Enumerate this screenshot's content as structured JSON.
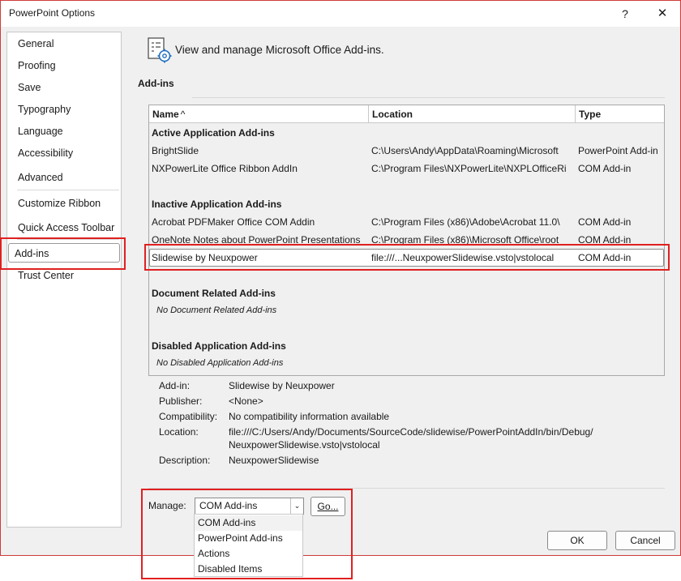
{
  "window": {
    "title": "PowerPoint Options",
    "help_glyph": "?",
    "close_glyph": "✕"
  },
  "sidebar": {
    "items": [
      {
        "label": "General"
      },
      {
        "label": "Proofing"
      },
      {
        "label": "Save"
      },
      {
        "label": "Typography"
      },
      {
        "label": "Language"
      },
      {
        "label": "Accessibility"
      },
      {
        "label": "Advanced"
      },
      {
        "label": "Customize Ribbon"
      },
      {
        "label": "Quick Access Toolbar"
      },
      {
        "label": "Add-ins",
        "selected": true
      },
      {
        "label": "Trust Center"
      }
    ]
  },
  "header": {
    "text": "View and manage Microsoft Office Add-ins.",
    "icon": "addins-gear-icon"
  },
  "section": {
    "label": "Add-ins"
  },
  "table": {
    "columns": {
      "name": "Name",
      "name_sort": "^",
      "location": "Location",
      "type": "Type"
    },
    "groups": {
      "active": {
        "heading": "Active Application Add-ins",
        "rows": [
          {
            "name": "BrightSlide",
            "location": "C:\\Users\\Andy\\AppData\\Roaming\\Microsoft",
            "type": "PowerPoint Add-in"
          },
          {
            "name": "NXPowerLite Office Ribbon AddIn",
            "location": "C:\\Program Files\\NXPowerLite\\NXPLOfficeRi",
            "type": "COM Add-in"
          }
        ]
      },
      "inactive": {
        "heading": "Inactive Application Add-ins",
        "rows": [
          {
            "name": "Acrobat PDFMaker Office COM Addin",
            "location": "C:\\Program Files (x86)\\Adobe\\Acrobat 11.0\\",
            "type": "COM Add-in"
          },
          {
            "name": "OneNote Notes about PowerPoint Presentations",
            "location": "C:\\Program Files (x86)\\Microsoft Office\\root",
            "type": "COM Add-in"
          },
          {
            "name": "Slidewise by Neuxpower",
            "location": "file:///...NeuxpowerSlidewise.vsto|vstolocal",
            "type": "COM Add-in",
            "selected": true
          }
        ]
      },
      "document": {
        "heading": "Document Related Add-ins",
        "empty": "No Document Related Add-ins"
      },
      "disabled": {
        "heading": "Disabled Application Add-ins",
        "empty": "No Disabled Application Add-ins"
      }
    }
  },
  "details": {
    "addin_label": "Add-in:",
    "addin_value": "Slidewise by Neuxpower",
    "publisher_label": "Publisher:",
    "publisher_value": "<None>",
    "compat_label": "Compatibility:",
    "compat_value": "No compatibility information available",
    "location_label": "Location:",
    "location_line1": "file:///C:/Users/Andy/Documents/SourceCode/slidewise/PowerPointAddIn/bin/Debug/",
    "location_line2": "NeuxpowerSlidewise.vsto|vstolocal",
    "description_label": "Description:",
    "description_value": "NeuxpowerSlidewise"
  },
  "manage": {
    "label": "Manage:",
    "selected": "COM Add-ins",
    "options": [
      "COM Add-ins",
      "PowerPoint Add-ins",
      "Actions",
      "Disabled Items"
    ],
    "go_label": "Go..."
  },
  "buttons": {
    "ok": "OK",
    "cancel": "Cancel"
  },
  "colors": {
    "highlight_box": "#e02020",
    "dialog_bg": "#f0f0f0"
  }
}
